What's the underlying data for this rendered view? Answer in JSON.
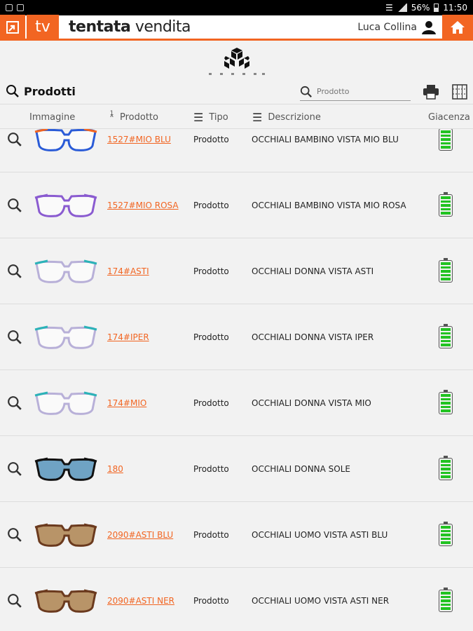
{
  "status_bar": {
    "battery": "56%",
    "time": "11:50"
  },
  "header": {
    "tv_label": "tv",
    "brand_bold": "tentata",
    "brand_light": " vendita",
    "user_name": "Luca Collina"
  },
  "page": {
    "title": "Prodotti",
    "search_placeholder": "Prodotto"
  },
  "columns": {
    "image": "Immagine",
    "sort_index": "1",
    "product": "Prodotto",
    "type": "Tipo",
    "description": "Descrizione",
    "stock": "Giacenza"
  },
  "rows": [
    {
      "code": "1527#MIO BLU",
      "type": "Prodotto",
      "description": "OCCHIALI BAMBINO VISTA MIO BLU",
      "frame_color": "#2a5bd7",
      "accent": "#f26522",
      "lens": "none"
    },
    {
      "code": "1527#MIO ROSA",
      "type": "Prodotto",
      "description": "OCCHIALI BAMBINO VISTA MIO ROSA",
      "frame_color": "#8a5bd0",
      "accent": "#8a5bd0",
      "lens": "none"
    },
    {
      "code": "174#ASTI",
      "type": "Prodotto",
      "description": "OCCHIALI DONNA VISTA ASTI",
      "frame_color": "#b8b0d8",
      "accent": "#2bb3b8",
      "lens": "none"
    },
    {
      "code": "174#IPER",
      "type": "Prodotto",
      "description": "OCCHIALI DONNA VISTA IPER",
      "frame_color": "#b8b0d8",
      "accent": "#2bb3b8",
      "lens": "none"
    },
    {
      "code": "174#MIO",
      "type": "Prodotto",
      "description": "OCCHIALI DONNA VISTA MIO",
      "frame_color": "#b8b0d8",
      "accent": "#2bb3b8",
      "lens": "none"
    },
    {
      "code": "180",
      "type": "Prodotto",
      "description": "OCCHIALI DONNA SOLE",
      "frame_color": "#111111",
      "accent": "#111111",
      "lens": "#6fa3c4"
    },
    {
      "code": "2090#ASTI BLU",
      "type": "Prodotto",
      "description": "OCCHIALI UOMO VISTA ASTI BLU",
      "frame_color": "#6b3a1e",
      "accent": "#6b3a1e",
      "lens": "#b89468"
    },
    {
      "code": "2090#ASTI NER",
      "type": "Prodotto",
      "description": "OCCHIALI UOMO VISTA ASTI NER",
      "frame_color": "#6b3a1e",
      "accent": "#6b3a1e",
      "lens": "#b89468"
    }
  ],
  "colors": {
    "accent": "#f26522",
    "stock_full": "#22c322"
  }
}
